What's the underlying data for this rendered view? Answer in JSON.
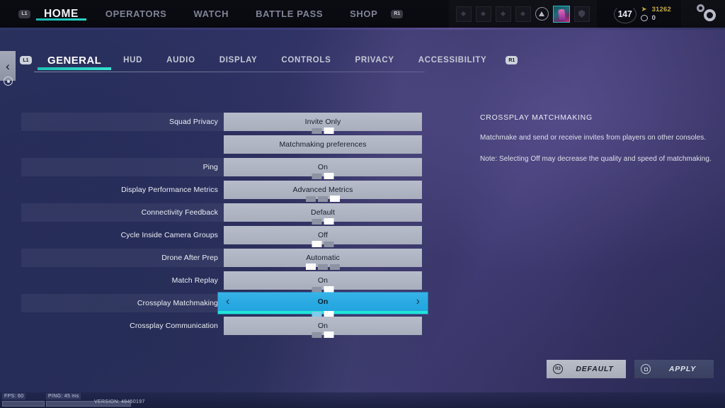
{
  "topbar": {
    "left_bumper": "L1",
    "right_bumper": "R1",
    "nav": [
      {
        "label": "HOME",
        "active": true
      },
      {
        "label": "OPERATORS",
        "active": false
      },
      {
        "label": "WATCH",
        "active": false
      },
      {
        "label": "BATTLE PASS",
        "active": false
      },
      {
        "label": "SHOP",
        "active": false
      }
    ],
    "level": "147",
    "currency": [
      {
        "icon": "renown-icon",
        "value": "31262"
      },
      {
        "icon": "credits-icon",
        "value": "0"
      }
    ],
    "settings_icon": "gear-icon"
  },
  "settings_tabs": {
    "left_bumper": "L1",
    "right_bumper": "R1",
    "back_icon": "chevron-left-icon",
    "back_button_icon": "circle-button-icon",
    "items": [
      {
        "label": "GENERAL",
        "active": true
      },
      {
        "label": "HUD",
        "active": false
      },
      {
        "label": "AUDIO",
        "active": false
      },
      {
        "label": "DISPLAY",
        "active": false
      },
      {
        "label": "CONTROLS",
        "active": false
      },
      {
        "label": "PRIVACY",
        "active": false
      },
      {
        "label": "ACCESSIBILITY",
        "active": false
      }
    ]
  },
  "settings_rows": [
    {
      "label": "Squad Privacy",
      "value": "Invite Only",
      "pips": 2,
      "pip_on": 1,
      "shaded": true,
      "selected": false
    },
    {
      "label": "",
      "value": "Matchmaking preferences",
      "pips": 0,
      "pip_on": -1,
      "shaded": false,
      "selected": false
    },
    {
      "label": "Ping",
      "value": "On",
      "pips": 2,
      "pip_on": 1,
      "shaded": true,
      "selected": false
    },
    {
      "label": "Display Performance Metrics",
      "value": "Advanced Metrics",
      "pips": 3,
      "pip_on": 2,
      "shaded": false,
      "selected": false
    },
    {
      "label": "Connectivity Feedback",
      "value": "Default",
      "pips": 2,
      "pip_on": 1,
      "shaded": true,
      "selected": false
    },
    {
      "label": "Cycle Inside Camera Groups",
      "value": "Off",
      "pips": 2,
      "pip_on": 0,
      "shaded": false,
      "selected": false
    },
    {
      "label": "Drone After Prep",
      "value": "Automatic",
      "pips": 3,
      "pip_on": 0,
      "shaded": true,
      "selected": false
    },
    {
      "label": "Match Replay",
      "value": "On",
      "pips": 2,
      "pip_on": 1,
      "shaded": false,
      "selected": false
    },
    {
      "label": "Crossplay Matchmaking",
      "value": "On",
      "pips": 2,
      "pip_on": 1,
      "shaded": true,
      "selected": true
    },
    {
      "label": "Crossplay Communication",
      "value": "On",
      "pips": 2,
      "pip_on": 1,
      "shaded": false,
      "selected": false
    }
  ],
  "selected_arrows": {
    "left": "‹",
    "right": "›"
  },
  "description": {
    "title": "CROSSPLAY MATCHMAKING",
    "paragraphs": [
      "Matchmake and send or receive invites from players on other consoles.",
      "Note: Selecting Off may decrease the quality and speed of matchmaking."
    ]
  },
  "actions": [
    {
      "label": "DEFAULT",
      "badge": "R3",
      "icon": "right-stick-icon",
      "style": "light"
    },
    {
      "label": "APPLY",
      "badge": "",
      "icon": "square-button-icon",
      "style": "dark"
    }
  ],
  "status": {
    "fps": "FPS: 60",
    "ping": "PING: 45 ms",
    "version": "VERSION: 48450197"
  },
  "colors": {
    "accent_teal": "#1fe6d8",
    "accent_blue": "#2aa9e2",
    "control_gray": "#b0b5c4",
    "background_navy": "#2c3162"
  }
}
